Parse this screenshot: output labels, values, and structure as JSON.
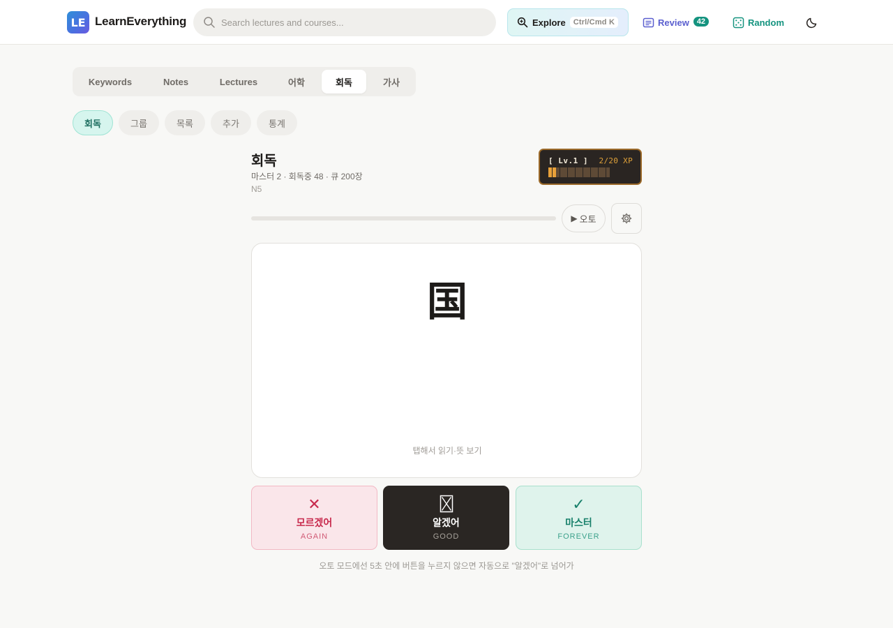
{
  "header": {
    "logo_badge": "LE",
    "logo_text": "LearnEverything",
    "search_placeholder": "Search lectures and courses...",
    "explore_label": "Explore",
    "explore_shortcut": "Ctrl/Cmd K",
    "review_label": "Review",
    "review_count": "42",
    "random_label": "Random",
    "icons": [
      "search-icon",
      "explore-icon",
      "review-icon",
      "dice-icon",
      "moon-icon"
    ]
  },
  "tabs": [
    {
      "label": "Keywords",
      "active": false
    },
    {
      "label": "Notes",
      "active": false
    },
    {
      "label": "Lectures",
      "active": false
    },
    {
      "label": "어학",
      "active": false
    },
    {
      "label": "회독",
      "active": true
    },
    {
      "label": "가사",
      "active": false
    }
  ],
  "subtabs": [
    {
      "label": "회독",
      "active": true
    },
    {
      "label": "그룹",
      "active": false
    },
    {
      "label": "목록",
      "active": false
    },
    {
      "label": "추가",
      "active": false
    },
    {
      "label": "통계",
      "active": false
    }
  ],
  "deck": {
    "title": "회독",
    "stats": "마스터 2 · 회독중 48 · 큐 200장",
    "level": "N5"
  },
  "xp": {
    "level": "[ Lv.1 ]",
    "value": "2/20 XP",
    "fraction": 0.1,
    "colors": {
      "filled": "#e8a13a",
      "empty": "#5e4a36"
    }
  },
  "session": {
    "progress": 0,
    "auto_label": "오토",
    "settings_icon": "gear-icon"
  },
  "card": {
    "character": "国",
    "hint": "탭해서 읽기·뜻 보기"
  },
  "answers": {
    "again": {
      "symbol": "✕",
      "label": "모르겠어",
      "sub": "AGAIN"
    },
    "good": {
      "symbol": "⌛",
      "label": "알겠어",
      "sub": "GOOD"
    },
    "master": {
      "symbol": "✓",
      "label": "마스터",
      "sub": "FOREVER"
    }
  },
  "footnote": "오토 모드에선 5초 안에 버튼을 누르지 않으면 자동으로 \"알겠어\"로 넘어가",
  "colors": {
    "accent": "#14937f",
    "review": "#5a5fcf",
    "again": "#c7294c"
  }
}
